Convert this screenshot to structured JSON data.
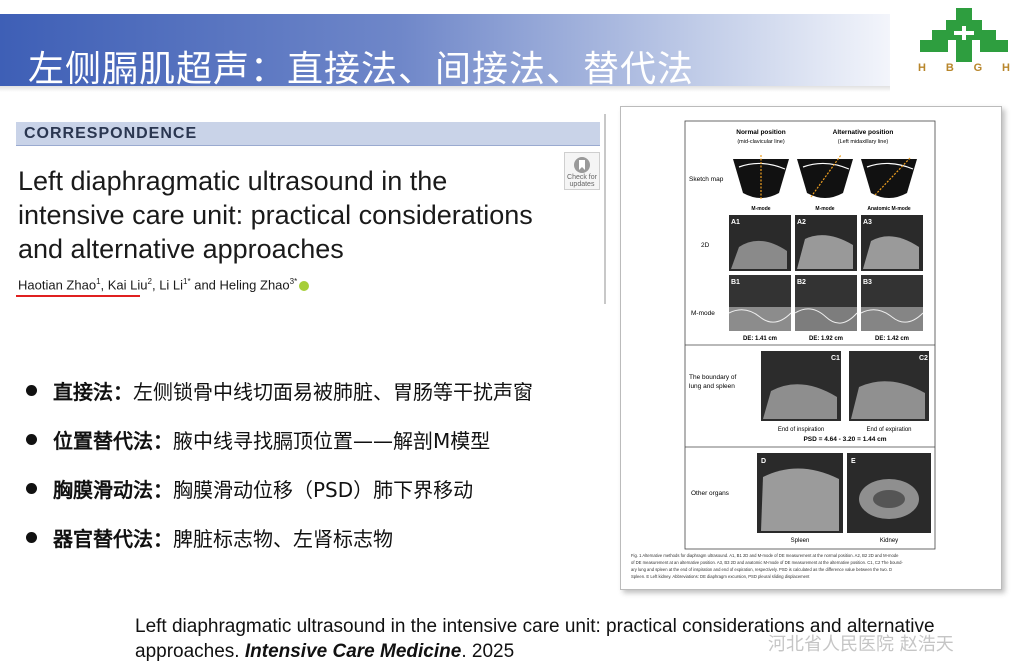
{
  "slide": {
    "title": "左侧膈肌超声：直接法、间接法、替代法",
    "logo_letters": [
      "H",
      "B",
      "G",
      "H"
    ],
    "colors": {
      "banner": "#3e5fb6",
      "logo_green": "#2e9e3f",
      "logo_gold": "#b8862b",
      "underline": "#e02020"
    }
  },
  "article": {
    "section": "CORRESPONDENCE",
    "title_lines": [
      "Left diaphragmatic ultrasound in the",
      "intensive care unit: practical considerations",
      "and alternative approaches"
    ],
    "check_for_updates": [
      "Check for",
      "updates"
    ],
    "authors": [
      {
        "name": "Haotian Zhao",
        "sup": "1",
        "sep": ", "
      },
      {
        "name": "Kai Liu",
        "sup": "2",
        "sep": ", "
      },
      {
        "name": "Li Li",
        "sup": "1*",
        "sep": " and "
      },
      {
        "name": "Heling Zhao",
        "sup": "3*",
        "sep": ""
      }
    ]
  },
  "bullets": [
    {
      "head": "直接法：",
      "text": "左侧锁骨中线切面易被肺脏、胃肠等干扰声窗"
    },
    {
      "head": "位置替代法：",
      "text": "腋中线寻找膈顶位置——解剖M模型"
    },
    {
      "head": "胸膜滑动法：",
      "text": "胸膜滑动位移（PSD）肺下界移动"
    },
    {
      "head": "器官替代法：",
      "text": "脾脏标志物、左肾标志物"
    }
  ],
  "figure": {
    "col_headers": [
      {
        "title": "Normal position",
        "sub": "(mid-clavicular line)"
      },
      {
        "title": "Alternative position",
        "sub": "(Left midaxillary line)"
      }
    ],
    "row_labels": [
      "Sketch map",
      "2D",
      "M-mode"
    ],
    "mode_labels": [
      "M-mode",
      "M-mode",
      "Anatomic M-mode"
    ],
    "panels_a": [
      "A1",
      "A2",
      "A3"
    ],
    "panels_b": [
      "B1",
      "B2",
      "B3"
    ],
    "de_values": [
      "DE: 1.41 cm",
      "DE: 1.92 cm",
      "DE: 1.42 cm"
    ],
    "boundary_label": [
      "The boundary of",
      "lung and spleen"
    ],
    "panels_c": [
      "C1",
      "C2"
    ],
    "phase_labels": [
      "End of inspiration",
      "End of expiration"
    ],
    "psd": "PSD = 4.64 - 3.20 = 1.44 cm",
    "other_label": "Other organs",
    "panels_de": [
      "D",
      "E"
    ],
    "organ_labels": [
      "Spleen",
      "Kidney"
    ],
    "caption": [
      "Fig. 1  Alternative methods for diaphragm ultrasound. A1, B1 2D and M-mode of DE measurement at the normal position. A2, B2 2D and M-mode",
      "of DE measurement at an alternative position. A3, B3 2D and anatomic M-mode of DE measurement at the alternative position. C1, C2 The bound-",
      "ary lung and spleen at the end of inspiration and end of expiration, respectively. PSD is calculated as the difference value between the two. D",
      "Spleen. E Left kidney. Abbreviations: DE diaphragm excursion, PSD pleural sliding displacement"
    ]
  },
  "citation": {
    "line1": "Left diaphragmatic ultrasound in the intensive care unit: practical considerations and alternative",
    "line2_prefix": "approaches. ",
    "journal": "Intensive Care Medicine",
    "year": ". 2025"
  },
  "watermark": "河北省人民医院  赵浩天"
}
